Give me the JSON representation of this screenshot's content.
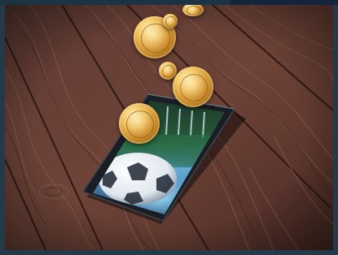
{
  "scene": {
    "subject": "",
    "colors": {
      "frame": "#243a4a",
      "topbar_accent": "#14243b",
      "wood_dark": "#3a1f1c",
      "wood_mid": "#6b3d33",
      "wood_light": "#8a5a4b",
      "coin_gold": "#e3b04e",
      "screen_glow": "#8fd0ff"
    }
  }
}
